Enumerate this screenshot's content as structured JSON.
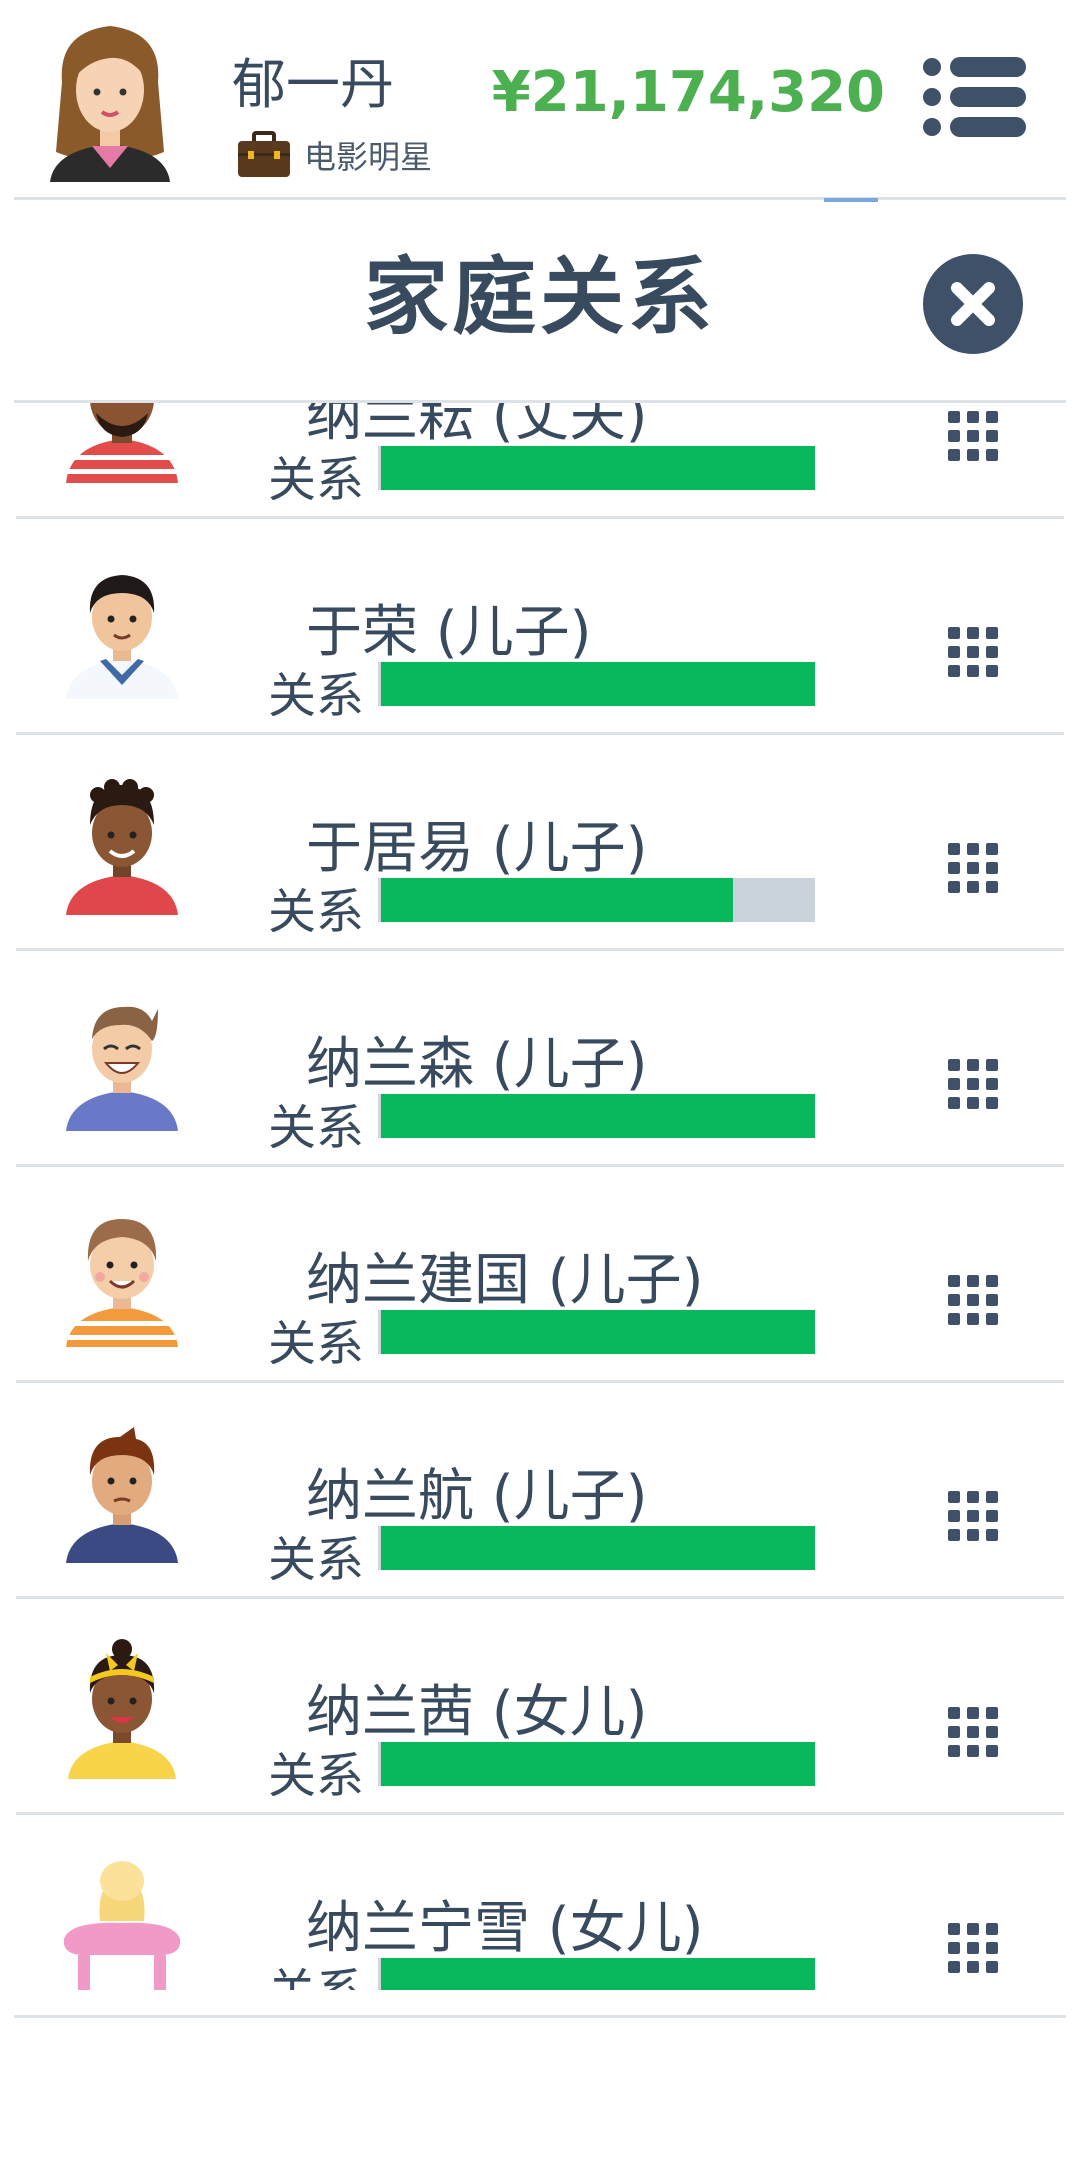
{
  "header": {
    "player_name": "郁一丹",
    "job_label": "电影明星",
    "money": "¥21,174,320",
    "avatar_icon": "woman-avatar-icon",
    "job_icon": "briefcase-icon",
    "menu_icon": "menu-icon"
  },
  "dialog": {
    "title": "家庭关系",
    "close_icon": "close-icon"
  },
  "colors": {
    "text": "#374a5e",
    "money": "#4caf50",
    "bar_fill": "#09b85a",
    "bar_track": "#c9d3dc"
  },
  "relationship_label": "关系",
  "family": [
    {
      "name": "纳兰耘 (丈夫)",
      "relationship": 1.0,
      "avatar": "man-red-striped-shirt-avatar"
    },
    {
      "name": "于荣 (儿子)",
      "relationship": 1.0,
      "avatar": "boy-sailor-avatar"
    },
    {
      "name": "于居易 (儿子)",
      "relationship": 0.81,
      "avatar": "boy-red-shirt-avatar"
    },
    {
      "name": "纳兰森 (儿子)",
      "relationship": 1.0,
      "avatar": "boy-laughing-avatar"
    },
    {
      "name": "纳兰建国 (儿子)",
      "relationship": 1.0,
      "avatar": "boy-orange-striped-avatar"
    },
    {
      "name": "纳兰航 (儿子)",
      "relationship": 1.0,
      "avatar": "boy-navy-shirt-avatar"
    },
    {
      "name": "纳兰茜 (女儿)",
      "relationship": 1.0,
      "avatar": "girl-yellow-bow-avatar"
    },
    {
      "name": "纳兰宁雪 (女儿)",
      "relationship": 1.0,
      "avatar": "baby-pacifier-avatar"
    }
  ]
}
